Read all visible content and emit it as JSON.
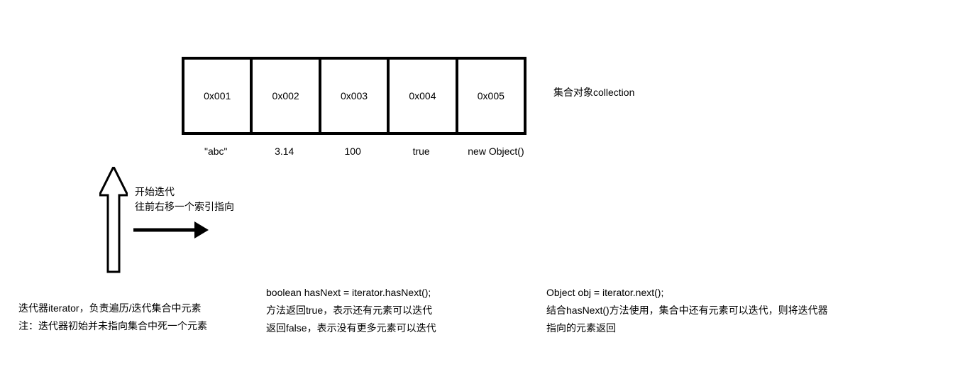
{
  "collection": {
    "cells": [
      "0x001",
      "0x002",
      "0x003",
      "0x004",
      "0x005"
    ],
    "values": [
      "\"abc\"",
      "3.14",
      "100",
      "true",
      "new Object()"
    ],
    "label": "集合对象collection"
  },
  "iter_action": {
    "line1": "开始迭代",
    "line2": "往前右移一个索引指向"
  },
  "iterator_desc": {
    "line1": "迭代器iterator，负责遍历/迭代集合中元素",
    "line2": "注：迭代器初始并未指向集合中死一个元素"
  },
  "hasnext": {
    "code": "boolean hasNext = iterator.hasNext();",
    "line1": "方法返回true，表示还有元素可以迭代",
    "line2": "返回false，表示没有更多元素可以迭代"
  },
  "next": {
    "code": "Object obj = iterator.next();",
    "line1": "结合hasNext()方法使用，集合中还有元素可以迭代，则将迭代器指向的元素返回"
  }
}
